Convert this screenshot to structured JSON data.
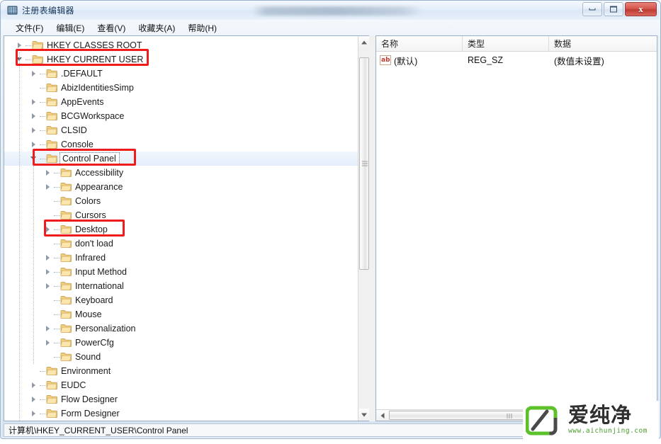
{
  "window": {
    "title": "注册表编辑器",
    "icon": "registry-editor-icon",
    "buttons": {
      "minimize": "最小化",
      "maximize": "最大化",
      "close": "x"
    }
  },
  "menu": {
    "items": [
      {
        "label": "文件(F)",
        "name": "menu-file"
      },
      {
        "label": "编辑(E)",
        "name": "menu-edit"
      },
      {
        "label": "查看(V)",
        "name": "menu-view"
      },
      {
        "label": "收藏夹(A)",
        "name": "menu-favorites"
      },
      {
        "label": "帮助(H)",
        "name": "menu-help"
      }
    ]
  },
  "tree": {
    "nodes": [
      {
        "label": "HKEY CLASSES ROOT",
        "depth": 0,
        "toggle": "closed",
        "selected": false
      },
      {
        "label": "HKEY CURRENT USER",
        "depth": 0,
        "toggle": "open",
        "selected": false
      },
      {
        "label": ".DEFAULT",
        "depth": 1,
        "toggle": "closed",
        "selected": false
      },
      {
        "label": "AbizIdentitiesSimp",
        "depth": 1,
        "toggle": "none",
        "selected": false
      },
      {
        "label": "AppEvents",
        "depth": 1,
        "toggle": "closed",
        "selected": false
      },
      {
        "label": "BCGWorkspace",
        "depth": 1,
        "toggle": "closed",
        "selected": false
      },
      {
        "label": "CLSID",
        "depth": 1,
        "toggle": "closed",
        "selected": false
      },
      {
        "label": "Console",
        "depth": 1,
        "toggle": "closed",
        "selected": false
      },
      {
        "label": "Control Panel",
        "depth": 1,
        "toggle": "open",
        "selected": true
      },
      {
        "label": "Accessibility",
        "depth": 2,
        "toggle": "closed",
        "selected": false
      },
      {
        "label": "Appearance",
        "depth": 2,
        "toggle": "closed",
        "selected": false
      },
      {
        "label": "Colors",
        "depth": 2,
        "toggle": "none",
        "selected": false
      },
      {
        "label": "Cursors",
        "depth": 2,
        "toggle": "none",
        "selected": false
      },
      {
        "label": "Desktop",
        "depth": 2,
        "toggle": "closed",
        "selected": false
      },
      {
        "label": "don't load",
        "depth": 2,
        "toggle": "none",
        "selected": false
      },
      {
        "label": "Infrared",
        "depth": 2,
        "toggle": "closed",
        "selected": false
      },
      {
        "label": "Input Method",
        "depth": 2,
        "toggle": "closed",
        "selected": false
      },
      {
        "label": "International",
        "depth": 2,
        "toggle": "closed",
        "selected": false
      },
      {
        "label": "Keyboard",
        "depth": 2,
        "toggle": "none",
        "selected": false
      },
      {
        "label": "Mouse",
        "depth": 2,
        "toggle": "none",
        "selected": false
      },
      {
        "label": "Personalization",
        "depth": 2,
        "toggle": "closed",
        "selected": false
      },
      {
        "label": "PowerCfg",
        "depth": 2,
        "toggle": "closed",
        "selected": false
      },
      {
        "label": "Sound",
        "depth": 2,
        "toggle": "none",
        "selected": false
      },
      {
        "label": "Environment",
        "depth": 1,
        "toggle": "none",
        "selected": false
      },
      {
        "label": "EUDC",
        "depth": 1,
        "toggle": "closed",
        "selected": false
      },
      {
        "label": "Flow Designer",
        "depth": 1,
        "toggle": "closed",
        "selected": false
      },
      {
        "label": "Form Designer",
        "depth": 1,
        "toggle": "closed",
        "selected": false
      }
    ]
  },
  "list": {
    "columns": [
      {
        "label": "名称",
        "name": "column-name"
      },
      {
        "label": "类型",
        "name": "column-type"
      },
      {
        "label": "数据",
        "name": "column-data"
      }
    ],
    "rows": [
      {
        "name": "(默认)",
        "type": "REG_SZ",
        "data": "(数值未设置)",
        "icon": "string-value-icon"
      }
    ]
  },
  "status": {
    "path": "计算机\\HKEY_CURRENT_USER\\Control Panel"
  },
  "annotations": {
    "color": "#ee1c1c",
    "boxes": [
      {
        "target": "HKEY CURRENT USER",
        "name": "annotation-hkey-current-user"
      },
      {
        "target": "Control Panel",
        "name": "annotation-control-panel"
      },
      {
        "target": "Desktop",
        "name": "annotation-desktop"
      }
    ]
  },
  "watermark": {
    "brand": "爱纯净",
    "url": "www.aichunjing.com",
    "accent": "#5cc12a"
  }
}
